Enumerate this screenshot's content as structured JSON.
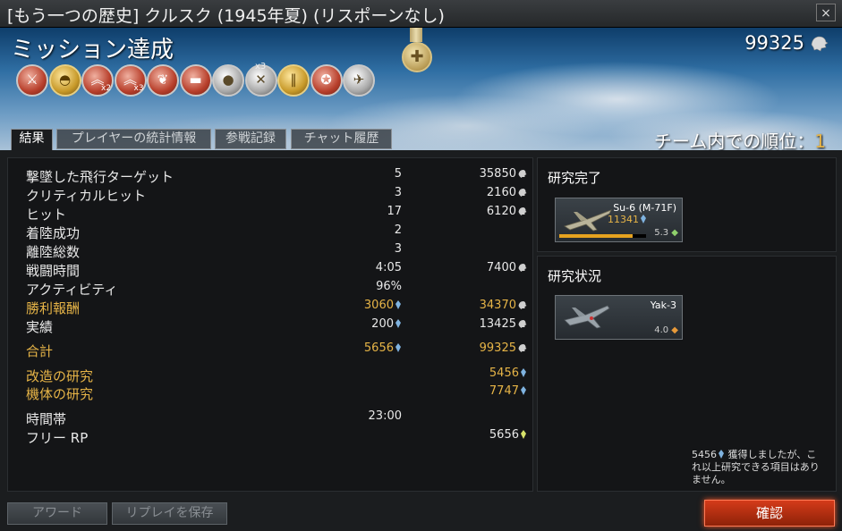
{
  "window": {
    "title": "[もう一つの歴史] クルスク (1945年夏) (リスポーンなし)",
    "close_label": "×"
  },
  "header": {
    "mission_status": "ミッション達成",
    "score": "99325",
    "awards_multiplier": "x3",
    "rank_label": "チーム内での順位：",
    "rank_value": "1"
  },
  "awards": [
    {
      "icon": "crossed-swords-icon",
      "style": "red",
      "mult": ""
    },
    {
      "icon": "helmet-icon",
      "style": "gold",
      "mult": ""
    },
    {
      "icon": "chevron-rank-icon",
      "style": "red",
      "mult": "x2"
    },
    {
      "icon": "chevron-rank-icon",
      "style": "red",
      "mult": "x3"
    },
    {
      "icon": "wreath-icon",
      "style": "red",
      "mult": ""
    },
    {
      "icon": "tank-icon",
      "style": "red",
      "mult": ""
    },
    {
      "icon": "bomb-icon",
      "style": "silver",
      "mult": ""
    },
    {
      "icon": "swords-icon",
      "style": "silver",
      "mult": ""
    },
    {
      "icon": "bars-icon",
      "style": "gold",
      "mult": ""
    },
    {
      "icon": "emblem-icon",
      "style": "red",
      "mult": ""
    },
    {
      "icon": "plane-icon",
      "style": "silver",
      "mult": ""
    }
  ],
  "tabs": [
    {
      "label": "結果"
    },
    {
      "label": "プレイヤーの統計情報"
    },
    {
      "label": "参戦記録"
    },
    {
      "label": "チャット履歴"
    }
  ],
  "stats": [
    {
      "label": "撃墜した飛行ターゲット",
      "count": "5",
      "value": "35850",
      "count_icon": "",
      "value_icon": "silver-lion-icon"
    },
    {
      "label": "クリティカルヒット",
      "count": "3",
      "value": "2160",
      "count_icon": "",
      "value_icon": "silver-lion-icon"
    },
    {
      "label": "ヒット",
      "count": "17",
      "value": "6120",
      "count_icon": "",
      "value_icon": "silver-lion-icon"
    },
    {
      "label": "着陸成功",
      "count": "2",
      "value": "",
      "count_icon": "",
      "value_icon": ""
    },
    {
      "label": "離陸総数",
      "count": "3",
      "value": "",
      "count_icon": "",
      "value_icon": ""
    },
    {
      "label": "戦闘時間",
      "count": "4:05",
      "value": "7400",
      "count_icon": "",
      "value_icon": "silver-lion-icon"
    },
    {
      "label": "アクティビティ",
      "count": "96%",
      "value": "",
      "count_icon": "",
      "value_icon": ""
    },
    {
      "label": "勝利報酬",
      "count": "3060",
      "value": "34370",
      "count_icon": "rp-icon",
      "value_icon": "silver-lion-icon",
      "gold": true
    },
    {
      "label": "実績",
      "count": "200",
      "value": "13425",
      "count_icon": "rp-icon",
      "value_icon": "silver-lion-icon"
    },
    {
      "label": "合計",
      "count": "5656",
      "value": "99325",
      "count_icon": "rp-icon",
      "value_icon": "silver-lion-icon",
      "gold": true
    },
    {
      "label": "改造の研究",
      "count": "",
      "value": "5456",
      "count_icon": "",
      "value_icon": "rp-icon",
      "gold": true
    },
    {
      "label": "機体の研究",
      "count": "",
      "value": "7747",
      "count_icon": "",
      "value_icon": "rp-icon",
      "gold": true
    },
    {
      "label": "時間帯",
      "count": "23:00",
      "value": "",
      "count_icon": "",
      "value_icon": ""
    },
    {
      "label": "フリー RP",
      "count": "",
      "value": "5656",
      "count_icon": "",
      "value_icon": "free-rp-icon"
    }
  ],
  "research_done": {
    "title": "研究完了",
    "vehicle": {
      "name": "Su-6 (M-71F)",
      "rp": "11341",
      "br": "5.3",
      "progress": 0.85
    }
  },
  "research_status": {
    "title": "研究状況",
    "vehicle": {
      "name": "Yak-3",
      "br": "4.0"
    },
    "rp": "5456",
    "message": "獲得しましたが、これ以上研究できる項目はありません。"
  },
  "footer": {
    "award_label": "アワード",
    "save_replay_label": "リプレイを保存",
    "confirm_label": "確認"
  },
  "colors": {
    "accent_gold": "#e6b447",
    "confirm_red": "#c8361a",
    "rp_blue": "#7fb3e0",
    "free_rp_yellow": "#d6e26a"
  }
}
